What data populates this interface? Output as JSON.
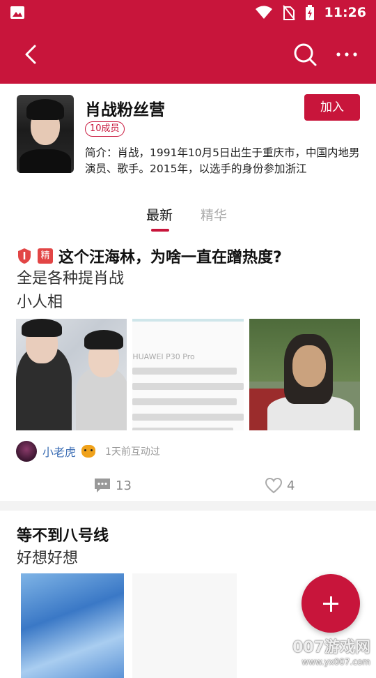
{
  "status_bar": {
    "time": "11:26"
  },
  "group": {
    "name": "肖战粉丝营",
    "members": "10成员",
    "join_label": "加入",
    "intro": "简介：肖战，1991年10月5日出生于重庆市，中国内地男演员、歌手。2015年，以选手的身份参加浙江"
  },
  "tabs": [
    {
      "label": "最新",
      "active": true
    },
    {
      "label": "精华",
      "active": false
    }
  ],
  "post1": {
    "badge": "精",
    "title": "这个汪海林，为啥一直在蹭热度?",
    "body": "全是各种提肖战\n小人相",
    "image2_label": "HUAWEI P30 Pro",
    "author": "小老虎",
    "time": "1天前互动过",
    "comments": "13",
    "likes": "4"
  },
  "post2": {
    "title": "等不到八号线",
    "body": "好想好想"
  },
  "watermark": {
    "brand": "007游戏网",
    "url": "www.yx007.com"
  },
  "colors": {
    "primary": "#c8153b",
    "badge": "#e24545"
  },
  "icons": [
    "image-icon",
    "wifi-icon",
    "no-sim-icon",
    "battery-icon",
    "back-icon",
    "search-icon",
    "more-icon",
    "pin-icon",
    "comment-icon",
    "heart-icon",
    "plus-icon"
  ]
}
